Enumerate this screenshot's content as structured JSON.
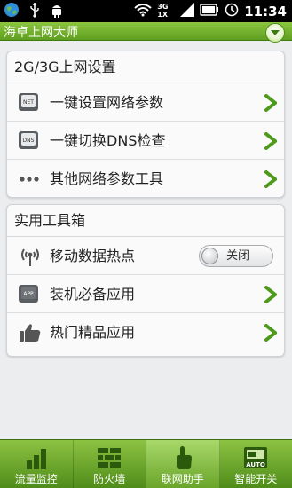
{
  "statusbar": {
    "icons": [
      "globe-icon",
      "usb-icon",
      "android-icon",
      "wifi-icon",
      "network-3g-icon",
      "signal-icon",
      "battery-icon",
      "alarm-icon"
    ],
    "network_label_top": "3G",
    "network_label_bottom": "1X",
    "time": "11:34"
  },
  "titlebar": {
    "title": "海卓上网大师",
    "menu_icon": "chevron-down-icon"
  },
  "section_network": {
    "header": "2G/3G上网设置",
    "items": [
      {
        "label": "一键设置网络参数",
        "icon": "net-icon",
        "icon_text": "NET"
      },
      {
        "label": "一键切换DNS检查",
        "icon": "dns-icon",
        "icon_text": "DNS"
      },
      {
        "label": "其他网络参数工具",
        "icon": "more-dots-icon"
      }
    ]
  },
  "section_tools": {
    "header": "实用工具箱",
    "items": [
      {
        "label": "移动数据热点",
        "icon": "hotspot-icon",
        "toggle_label": "关闭"
      },
      {
        "label": "装机必备应用",
        "icon": "app-icon",
        "icon_text": "APP"
      },
      {
        "label": "热门精品应用",
        "icon": "thumbs-up-icon"
      }
    ]
  },
  "tabbar": {
    "tabs": [
      {
        "label": "流量监控",
        "icon": "bar-chart-icon",
        "active": false
      },
      {
        "label": "防火墙",
        "icon": "firewall-icon",
        "active": false
      },
      {
        "label": "联网助手",
        "icon": "hand-tap-icon",
        "active": true
      },
      {
        "label": "智能开关",
        "icon": "auto-switch-icon",
        "icon_text": "AUTO",
        "active": false
      }
    ]
  },
  "colors": {
    "accent_green": "#6cae2a",
    "chevron_green": "#4e9a1c",
    "background": "#ecedef"
  }
}
